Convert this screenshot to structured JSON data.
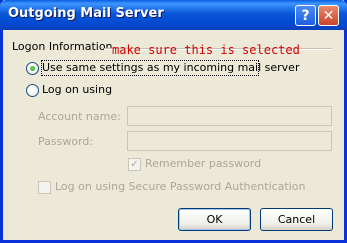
{
  "window": {
    "title": "Outgoing Mail Server",
    "help_glyph": "?",
    "close_glyph": "✕"
  },
  "group": {
    "label": "Logon Information",
    "annotation": "make sure this is selected"
  },
  "options": {
    "use_same_label": "Use same settings as my incoming mail server",
    "use_same_selected": true,
    "log_on_using_label": "Log on using",
    "log_on_using_selected": false
  },
  "fields": {
    "account_name_label": "Account name:",
    "account_name_value": "",
    "password_label": "Password:",
    "password_value": ""
  },
  "checkboxes": {
    "remember_password_label": "Remember password",
    "remember_password_checked": true,
    "spa_label": "Log on using Secure Password Authentication",
    "spa_checked": false
  },
  "buttons": {
    "ok": "OK",
    "cancel": "Cancel"
  },
  "colors": {
    "title_bar": "#0a56d8",
    "annotation": "#d40000",
    "disabled_text": "#aca899"
  }
}
